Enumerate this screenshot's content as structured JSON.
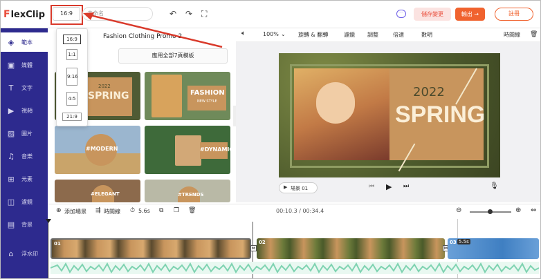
{
  "topbar": {
    "logo_mark": "F",
    "logo_text": "lexClip",
    "ratio": "16:9",
    "title_placeholder": "未命名",
    "save_label": "儲存變更",
    "export_label": "輸出 →",
    "register_label": "註冊"
  },
  "sidebar": {
    "items": [
      {
        "label": "範本",
        "icon": "template-icon"
      },
      {
        "label": "媒體",
        "icon": "media-icon"
      },
      {
        "label": "文字",
        "icon": "text-icon"
      },
      {
        "label": "視頻",
        "icon": "video-icon"
      },
      {
        "label": "圖片",
        "icon": "image-icon"
      },
      {
        "label": "音樂",
        "icon": "music-icon"
      },
      {
        "label": "元素",
        "icon": "elements-icon"
      },
      {
        "label": "濾鏡",
        "icon": "overlay-icon"
      },
      {
        "label": "背景",
        "icon": "background-icon"
      },
      {
        "label": "浮水印",
        "icon": "watermark-icon"
      }
    ]
  },
  "ratio_menu": [
    "16:9",
    "1:1",
    "9:16",
    "4:5",
    "21:9"
  ],
  "panel": {
    "title": "Fashion Clothing Promo 2",
    "apply_label": "應用全部7頁模板",
    "thumbs": [
      {
        "year": "2022",
        "text": "SPRING"
      },
      {
        "text": "FASHION",
        "sub": "NEW STYLE"
      },
      {
        "text": "#MODERN"
      },
      {
        "text": "#DYNAMIC"
      },
      {
        "text": "#ELEGANT"
      },
      {
        "text": "#TRENDS"
      }
    ]
  },
  "preview_toolbar": {
    "zoom": "100%",
    "items": [
      "旋轉 & 翻轉",
      "濾鏡",
      "調整",
      "倍速",
      "數明"
    ],
    "timeline": "時間線"
  },
  "stage": {
    "year": "2022",
    "headline": "SPRING"
  },
  "playbar": {
    "scene": "場景 01"
  },
  "timeline_toolbar": {
    "add_scene": "添加場景",
    "timeline": "時間線",
    "duration": "5.6s",
    "time": "00:10.3 / 00:34.4"
  },
  "clips": [
    {
      "label": "01"
    },
    {
      "label": "02"
    },
    {
      "label": "03",
      "duration": "5.5s"
    }
  ],
  "colors": {
    "sidebar": "#2d2a8e",
    "accent": "#f0622e",
    "brand_red": "#e94e3c",
    "spring_tan": "#c8955d",
    "audio": "#7fd3b1"
  }
}
